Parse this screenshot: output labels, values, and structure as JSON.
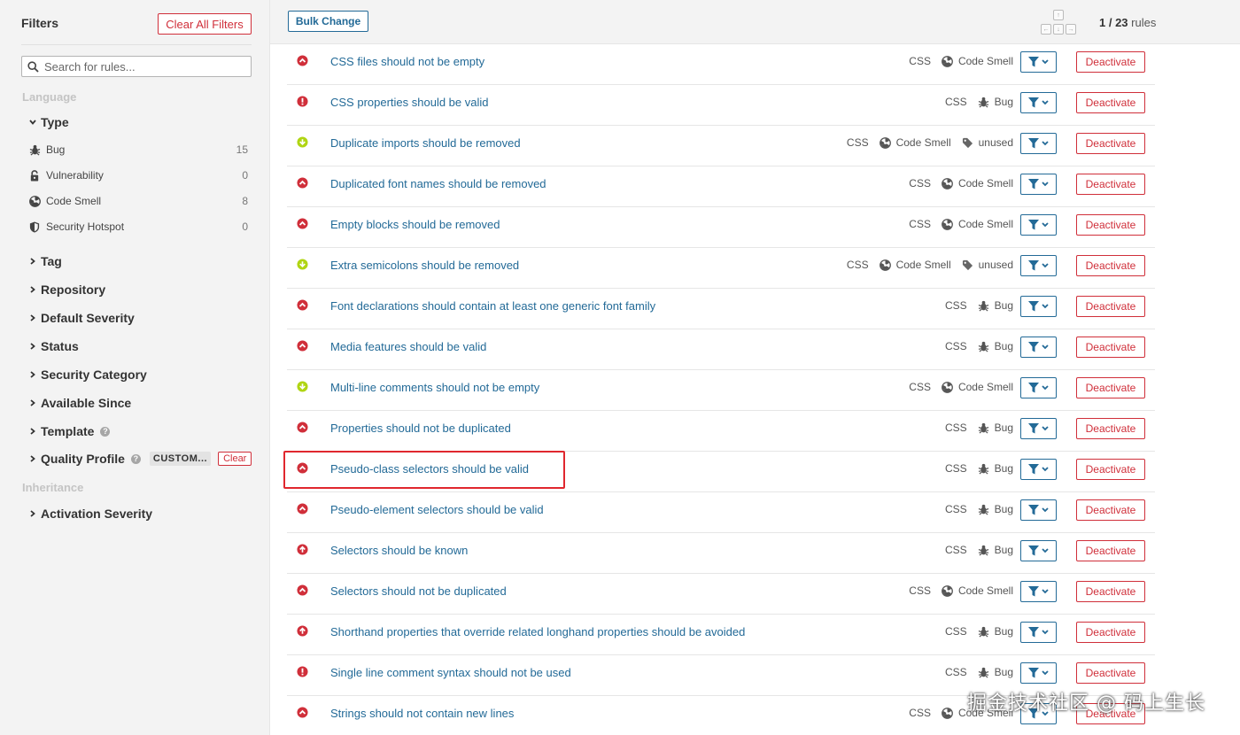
{
  "sidebar": {
    "title": "Filters",
    "clear_all_label": "Clear All Filters",
    "search_placeholder": "Search for rules...",
    "section_language": "Language",
    "type": {
      "label": "Type",
      "items": [
        {
          "label": "Bug",
          "count": "15",
          "icon": "bug-icon"
        },
        {
          "label": "Vulnerability",
          "count": "0",
          "icon": "lock-icon"
        },
        {
          "label": "Code Smell",
          "count": "8",
          "icon": "radiation-icon"
        },
        {
          "label": "Security Hotspot",
          "count": "0",
          "icon": "shield-icon"
        }
      ]
    },
    "facets": [
      "Tag",
      "Repository",
      "Default Severity",
      "Status",
      "Security Category",
      "Available Since",
      "Template"
    ],
    "quality_profile": {
      "label": "Quality Profile",
      "badge": "CUSTOM...",
      "clear_label": "Clear"
    },
    "section_inheritance": "Inheritance",
    "activation_severity": "Activation Severity"
  },
  "toolbar": {
    "bulk_change_label": "Bulk Change",
    "paging_current": "1",
    "paging_total": "23",
    "paging_suffix": "rules"
  },
  "colors": {
    "accent": "#236a97",
    "danger": "#d02f3a",
    "minor": "#b0d513",
    "highlight": "#e0272e"
  },
  "rows": [
    {
      "name": "CSS files should not be empty",
      "lang": "CSS",
      "type": "Code Smell",
      "tag": "",
      "severity": "critical"
    },
    {
      "name": "CSS properties should be valid",
      "lang": "CSS",
      "type": "Bug",
      "tag": "",
      "severity": "blocker"
    },
    {
      "name": "Duplicate imports should be removed",
      "lang": "CSS",
      "type": "Code Smell",
      "tag": "unused",
      "severity": "minor"
    },
    {
      "name": "Duplicated font names should be removed",
      "lang": "CSS",
      "type": "Code Smell",
      "tag": "",
      "severity": "critical"
    },
    {
      "name": "Empty blocks should be removed",
      "lang": "CSS",
      "type": "Code Smell",
      "tag": "",
      "severity": "critical"
    },
    {
      "name": "Extra semicolons should be removed",
      "lang": "CSS",
      "type": "Code Smell",
      "tag": "unused",
      "severity": "minor"
    },
    {
      "name": "Font declarations should contain at least one generic font family",
      "lang": "CSS",
      "type": "Bug",
      "tag": "",
      "severity": "critical"
    },
    {
      "name": "Media features should be valid",
      "lang": "CSS",
      "type": "Bug",
      "tag": "",
      "severity": "critical"
    },
    {
      "name": "Multi-line comments should not be empty",
      "lang": "CSS",
      "type": "Code Smell",
      "tag": "",
      "severity": "minor"
    },
    {
      "name": "Properties should not be duplicated",
      "lang": "CSS",
      "type": "Bug",
      "tag": "",
      "severity": "critical"
    },
    {
      "name": "Pseudo-class selectors should be valid",
      "lang": "CSS",
      "type": "Bug",
      "tag": "",
      "severity": "critical"
    },
    {
      "name": "Pseudo-element selectors should be valid",
      "lang": "CSS",
      "type": "Bug",
      "tag": "",
      "severity": "critical"
    },
    {
      "name": "Selectors should be known",
      "lang": "CSS",
      "type": "Bug",
      "tag": "",
      "severity": "major"
    },
    {
      "name": "Selectors should not be duplicated",
      "lang": "CSS",
      "type": "Code Smell",
      "tag": "",
      "severity": "critical"
    },
    {
      "name": "Shorthand properties that override related longhand properties should be avoided",
      "lang": "CSS",
      "type": "Bug",
      "tag": "",
      "severity": "major"
    },
    {
      "name": "Single line comment syntax should not be used",
      "lang": "CSS",
      "type": "Bug",
      "tag": "",
      "severity": "blocker"
    },
    {
      "name": "Strings should not contain new lines",
      "lang": "CSS",
      "type": "Code Smell",
      "tag": "",
      "severity": "critical"
    }
  ],
  "deactivate_label": "Deactivate",
  "highlighted_row": "Pseudo-class selectors should be valid",
  "watermark": "掘金技术社区 @ 码上生长"
}
